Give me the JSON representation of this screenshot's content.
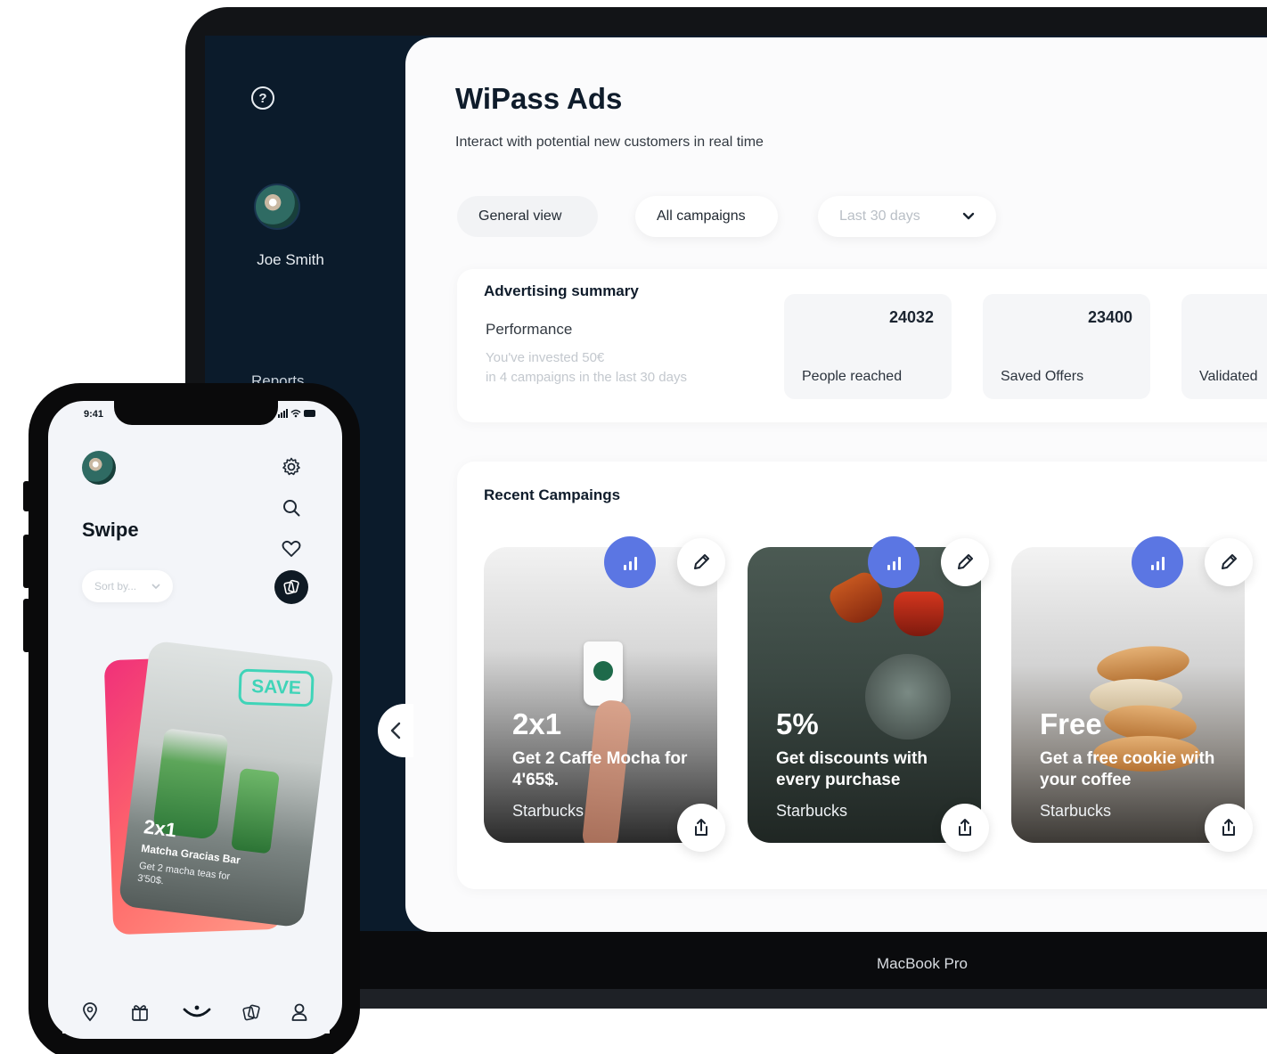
{
  "laptop": {
    "label": "MacBook Pro",
    "sidebar": {
      "user_name": "Joe Smith",
      "help_icon": "?",
      "nav_partial": "Reports"
    },
    "header": {
      "title": "WiPass Ads",
      "subtitle": "Interact with potential new customers in real time"
    },
    "filters": {
      "general_view": "General view",
      "all_campaigns": "All campaigns",
      "date_range": "Last 30 days"
    },
    "summary": {
      "title": "Advertising summary",
      "performance_label": "Performance",
      "note_line1": "You've invested 50€",
      "note_line2": "in 4 campaigns in the last 30 days",
      "stats": [
        {
          "value": "24032",
          "label": "People reached"
        },
        {
          "value": "23400",
          "label": "Saved Offers"
        },
        {
          "value": "",
          "label": "Validated"
        }
      ]
    },
    "recent": {
      "title": "Recent Campaings",
      "campaigns": [
        {
          "headline": "2x1",
          "description": "Get 2 Caffe Mocha for 4'65$.",
          "brand": "Starbucks"
        },
        {
          "headline": "5%",
          "description": "Get discounts with every purchase",
          "brand": "Starbucks"
        },
        {
          "headline": "Free",
          "description": "Get a free cookie with your coffee",
          "brand": "Starbucks"
        }
      ]
    }
  },
  "phone": {
    "time": "9:41",
    "title": "Swipe",
    "sort_placeholder": "Sort by...",
    "save_stamp": "SAVE",
    "card": {
      "headline": "2x1",
      "name": "Matcha Gracias Bar",
      "description": "Get 2 macha teas for 3'50$."
    }
  },
  "icons": {
    "help": "help-circle-icon",
    "stats": "bar-chart-icon",
    "edit": "pencil-icon",
    "share": "share-icon",
    "collapse": "chevron-left-icon",
    "dropdown": "chevron-down-icon",
    "settings": "gear-icon",
    "search": "search-icon",
    "favorites": "heart-icon",
    "swipe": "cards-icon",
    "nav": [
      "location-pin-icon",
      "gift-icon",
      "smile-icon",
      "cards-icon",
      "user-icon"
    ]
  },
  "colors": {
    "sidebar_bg": "#0b1b2b",
    "accent_blue": "#5b76e3",
    "save_teal": "#3fd4b8"
  }
}
